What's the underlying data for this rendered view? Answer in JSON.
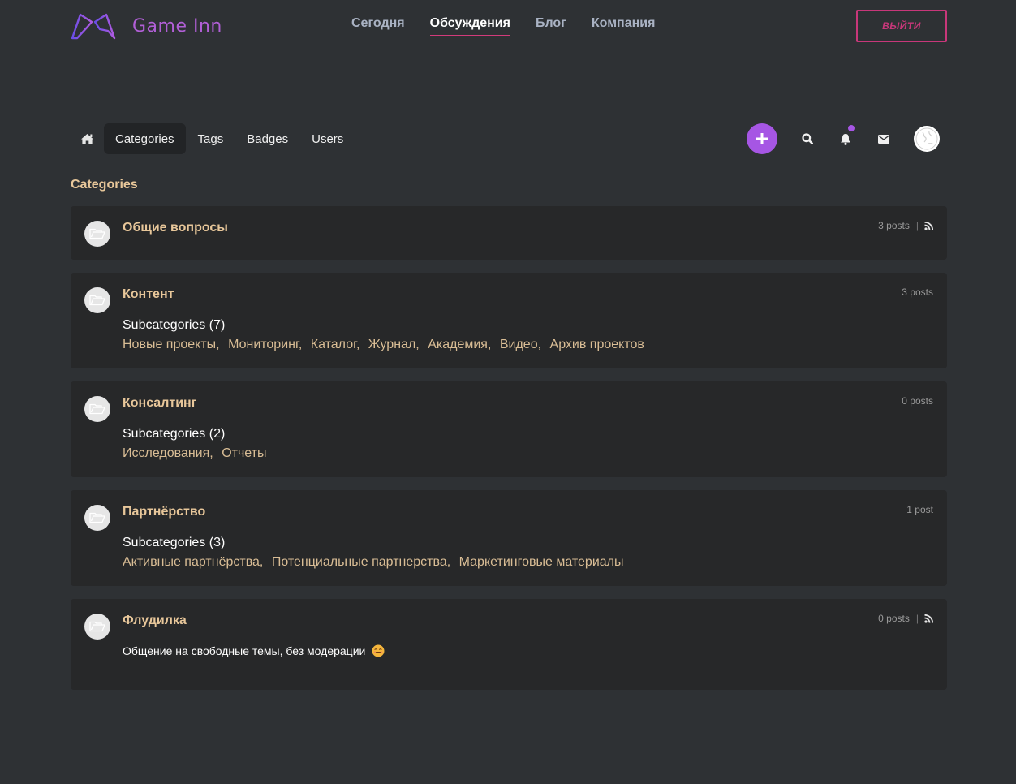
{
  "site": {
    "logo_text": "Game Inn",
    "nav": [
      {
        "label": "Сегодня",
        "active": false
      },
      {
        "label": "Обсуждения",
        "active": true
      },
      {
        "label": "Блог",
        "active": false
      },
      {
        "label": "Компания",
        "active": false
      }
    ],
    "logout_label": "ВЫЙТИ"
  },
  "forum_nav": {
    "home_icon": "home-icon",
    "tabs": [
      {
        "label": "Categories",
        "active": true
      },
      {
        "label": "Tags",
        "active": false
      },
      {
        "label": "Badges",
        "active": false
      },
      {
        "label": "Users",
        "active": false
      }
    ],
    "actions": [
      "plus-icon",
      "search-icon",
      "bell-icon",
      "envelope-icon",
      "avatar"
    ]
  },
  "page": {
    "heading": "Categories"
  },
  "categories": [
    {
      "title": "Общие вопросы",
      "posts": "3 posts",
      "rss": true,
      "subcategories_label": "",
      "subcategories": [],
      "description": ""
    },
    {
      "title": "Контент",
      "posts": "3 posts",
      "rss": false,
      "subcategories_label": "Subcategories (7)",
      "subcategories": [
        "Новые проекты",
        "Мониторинг",
        "Каталог",
        "Журнал",
        "Академия",
        "Видео",
        "Архив проектов"
      ],
      "description": ""
    },
    {
      "title": "Консалтинг",
      "posts": "0 posts",
      "rss": false,
      "subcategories_label": "Subcategories (2)",
      "subcategories": [
        "Исследования",
        "Отчеты"
      ],
      "description": ""
    },
    {
      "title": "Партнёрство",
      "posts": "1 post",
      "rss": false,
      "subcategories_label": "Subcategories (3)",
      "subcategories": [
        "Активные партнёрства",
        "Потенциальные партнерства",
        "Маркетинговые материалы"
      ],
      "description": ""
    },
    {
      "title": "Флудилка",
      "posts": "0 posts",
      "rss": true,
      "subcategories_label": "",
      "subcategories": [],
      "description": "Общение на свободные темы, без модерации"
    }
  ],
  "colors": {
    "background": "#2e3134",
    "card": "#272829",
    "accent_purple": "#a656e4",
    "accent_pink": "#c8377a",
    "category_title": "#e8c79a"
  }
}
